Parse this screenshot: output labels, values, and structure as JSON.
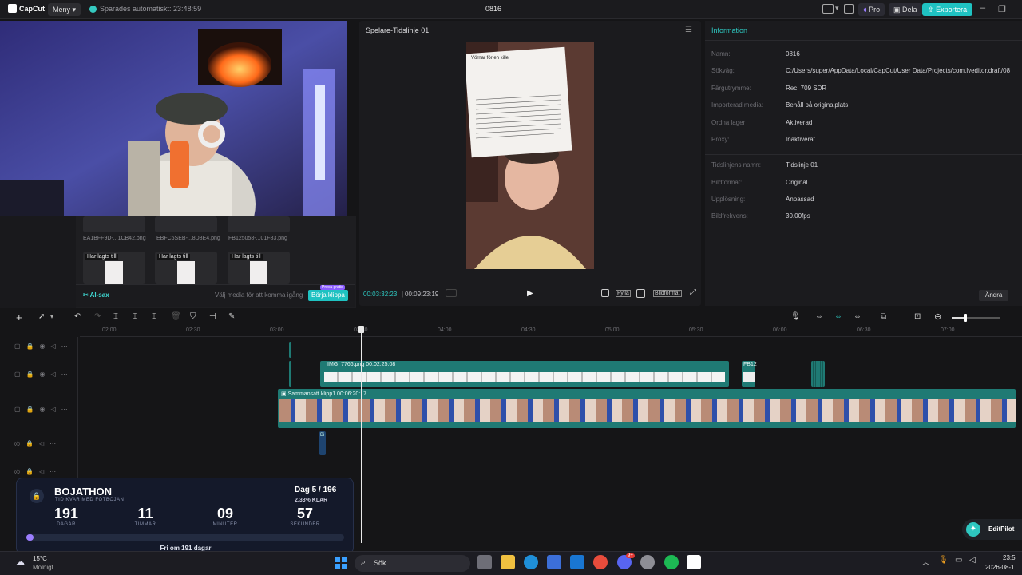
{
  "app": {
    "logo": "CapCut",
    "menu_label": "Meny",
    "saved_status": "Sparades automatiskt: 23:48:59",
    "project_title": "0816",
    "pro_label": "Pro",
    "share_label": "Dela",
    "export_label": "Exportera"
  },
  "media": {
    "thumbs": [
      {
        "label": "EA1BFF9D-...1CB42.png"
      },
      {
        "label": "EBFC6SEB-...8D8E4.png"
      },
      {
        "label": "FB125058-...01F83.png"
      }
    ],
    "added_label": "Har lagts till",
    "ai_label": "AI-sax",
    "hint": "Välj media för att komma igång",
    "start_button": "Börja klippa",
    "trial_badge": "Prova gratis"
  },
  "player": {
    "title": "Spelare-Tidslinje 01",
    "time_current": "00:03:32:23",
    "time_total": "00:09:23:19",
    "fill_label": "Fylla",
    "ratio_label": "Bildformat",
    "note_title": "Vörnar för en kille"
  },
  "info": {
    "title": "Information",
    "rows1": [
      {
        "key": "Namn:",
        "value": "0816"
      },
      {
        "key": "Sökväg:",
        "value": "C:/Users/super/AppData/Local/CapCut/User Data/Projects/com.lveditor.draft/08"
      },
      {
        "key": "Färgutrymme:",
        "value": "Rec. 709 SDR"
      },
      {
        "key": "Importerad media:",
        "value": "Behåll på originalplats"
      },
      {
        "key": "Ordna lager",
        "value": "Aktiverad"
      },
      {
        "key": "Proxy:",
        "value": "Inaktiverat"
      }
    ],
    "rows2": [
      {
        "key": "Tidslinjens namn:",
        "value": "Tidslinje 01"
      },
      {
        "key": "Bildformat:",
        "value": "Original"
      },
      {
        "key": "Upplösning:",
        "value": "Anpassad"
      },
      {
        "key": "Bildfrekvens:",
        "value": "30.00fps"
      }
    ],
    "change_button": "Ändra"
  },
  "timeline": {
    "ticks": [
      "02:00",
      "02:30",
      "03:00",
      "03:30",
      "04:00",
      "04:30",
      "05:00",
      "05:30",
      "06:00",
      "06:30",
      "07:00"
    ],
    "clip_png": "IMG_7766.png  00:02:25:08",
    "clip_fb": "FB12",
    "clip_compound": "Sammansatt klipp1  00:06:20:17",
    "clip_small": "Bi"
  },
  "overlay": {
    "title": "BOJATHON",
    "subtitle": "TID KVAR MED FOTBOJAN",
    "day": "Dag 5 / 196",
    "percent": "2.33% KLAR",
    "counters": [
      {
        "value": "191",
        "label": "DAGAR"
      },
      {
        "value": "11",
        "label": "TIMMAR"
      },
      {
        "value": "09",
        "label": "MINUTER"
      },
      {
        "value": "57",
        "label": "SEKUNDER"
      }
    ],
    "progress": 0.0233,
    "footer": "Fri om 191 dagar"
  },
  "editpilot": "EditPilot",
  "taskbar": {
    "temp": "15°C",
    "weather": "Molnigt",
    "search": "Sök",
    "badge": "9+",
    "time": "23:5",
    "date": "2026-08-1"
  },
  "colors": {
    "accent": "#1fc2c2",
    "clip": "#1f7a74",
    "overlay_bg": "#14192a"
  }
}
